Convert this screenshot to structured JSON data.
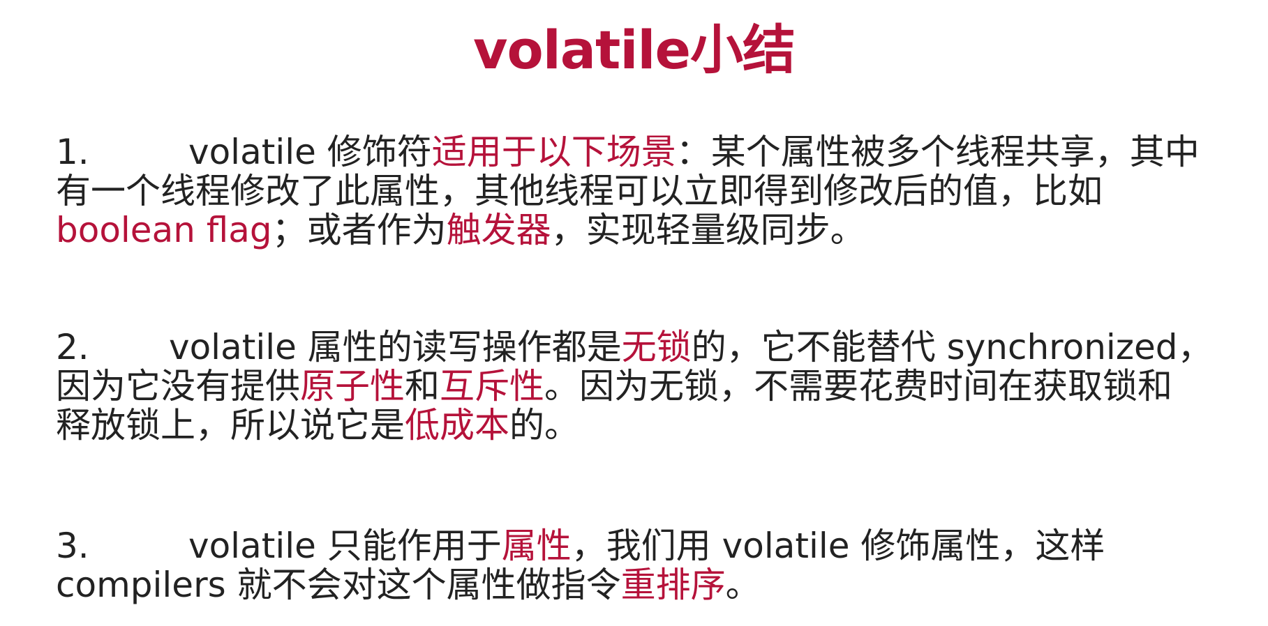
{
  "colors": {
    "accent": "#b5123a",
    "text": "#222222",
    "background": "#ffffff"
  },
  "title": "volatile小结",
  "points": [
    {
      "number": "1.",
      "lines": [
        [
          {
            "text": "volatile 修饰符",
            "hl": false
          },
          {
            "text": "适用于以下场景",
            "hl": true
          },
          {
            "text": "：某个属性被多个线程共享，其中",
            "hl": false
          }
        ],
        [
          {
            "text": "有一个线程修改了此属性，其他线程可以立即得到修改后的值，比如",
            "hl": false
          }
        ],
        [
          {
            "text": "boolean flag",
            "hl": true
          },
          {
            "text": "；或者作为",
            "hl": false
          },
          {
            "text": "触发器",
            "hl": true
          },
          {
            "text": "，实现轻量级同步。",
            "hl": false
          }
        ]
      ]
    },
    {
      "number": "2.",
      "lines": [
        [
          {
            "text": "volatile 属性的读写操作都是",
            "hl": false
          },
          {
            "text": "无锁",
            "hl": true
          },
          {
            "text": "的，它不能替代 synchronized，",
            "hl": false
          }
        ],
        [
          {
            "text": "因为它没有提供",
            "hl": false
          },
          {
            "text": "原子性",
            "hl": true
          },
          {
            "text": "和",
            "hl": false
          },
          {
            "text": "互斥性",
            "hl": true
          },
          {
            "text": "。因为无锁，不需要花费时间在获取锁和",
            "hl": false
          }
        ],
        [
          {
            "text": "释放锁上，所以说它是",
            "hl": false
          },
          {
            "text": "低成本",
            "hl": true
          },
          {
            "text": "的。",
            "hl": false
          }
        ]
      ]
    },
    {
      "number": "3.",
      "lines": [
        [
          {
            "text": "volatile 只能作用于",
            "hl": false
          },
          {
            "text": "属性",
            "hl": true
          },
          {
            "text": "，我们用 volatile 修饰属性，这样",
            "hl": false
          }
        ],
        [
          {
            "text": "compilers 就不会对这个属性做指令",
            "hl": false
          },
          {
            "text": "重排序",
            "hl": true
          },
          {
            "text": "。",
            "hl": false
          }
        ]
      ]
    }
  ]
}
